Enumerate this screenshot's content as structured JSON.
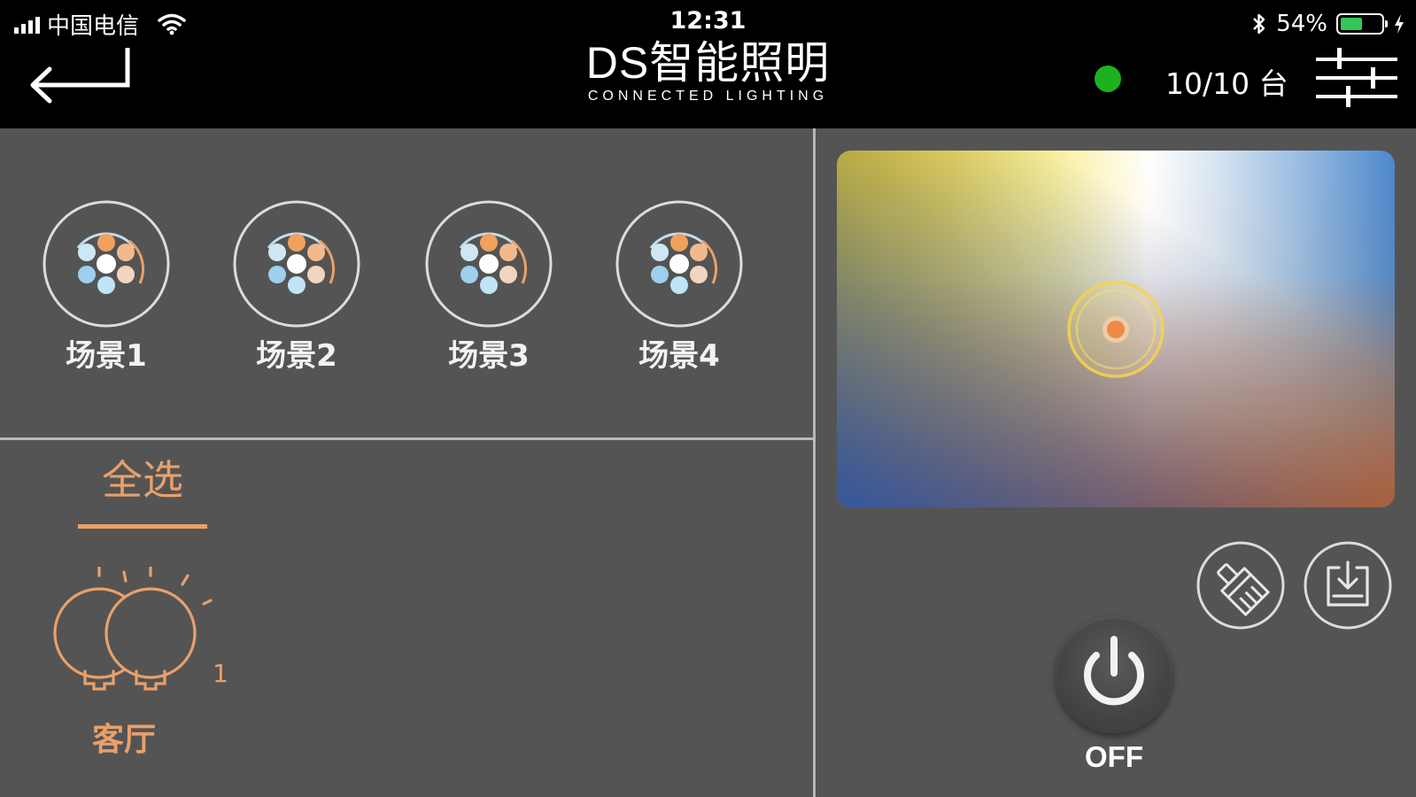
{
  "status_bar": {
    "carrier": "中国电信",
    "time": "12:31",
    "battery_percent": "54%",
    "battery_level": 0.54
  },
  "header": {
    "back_icon": "back-return-arrow-icon",
    "title": "DS智能照明",
    "subtitle": "CONNECTED LIGHTING",
    "online_status_color": "#1db11d",
    "device_count": "10/10 台",
    "settings_icon": "sliders-icon"
  },
  "scenes": {
    "items": [
      {
        "label": "场景1",
        "icon": "scene-dots-icon"
      },
      {
        "label": "场景2",
        "icon": "scene-dots-icon"
      },
      {
        "label": "场景3",
        "icon": "scene-dots-icon"
      },
      {
        "label": "场景4",
        "icon": "scene-dots-icon"
      }
    ]
  },
  "groups": {
    "select_all_label": "全选",
    "items": [
      {
        "label": "客厅",
        "count": "1",
        "icon": "double-bulb-icon"
      }
    ]
  },
  "color_picker": {
    "selected_x": 0.5,
    "selected_y": 0.5
  },
  "actions": {
    "clean_icon": "brush-icon",
    "save_icon": "save-download-icon",
    "power_icon": "power-icon",
    "power_label": "OFF"
  },
  "colors": {
    "accent": "#e9a06a",
    "background": "#545454",
    "topbar": "#000000",
    "divider": "#b8b8b8"
  }
}
